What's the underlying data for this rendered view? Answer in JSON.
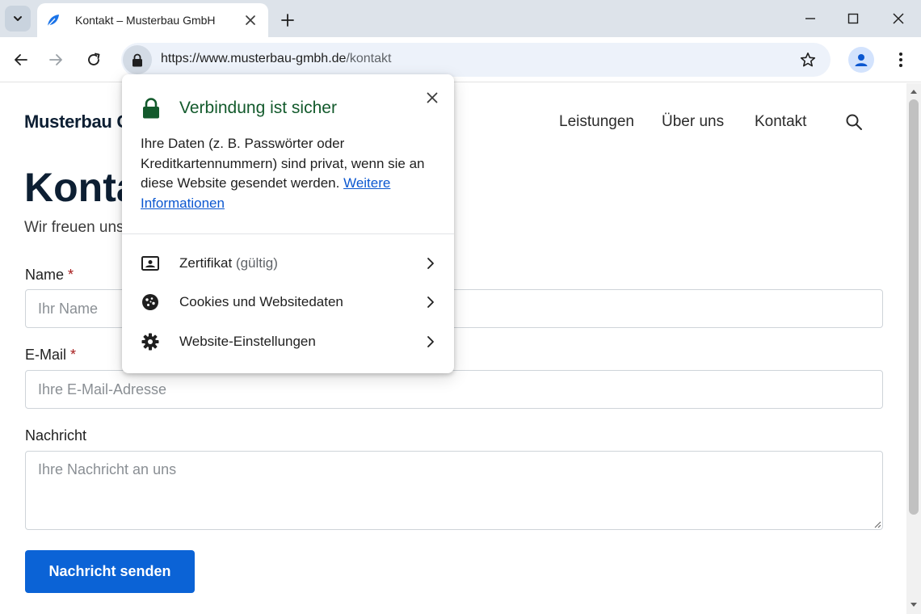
{
  "browser": {
    "tab": {
      "title": "Kontakt – Musterbau GmbH"
    },
    "address_bar": {
      "url_host": "https://www.musterbau-gmbh.de",
      "url_path": "/kontakt"
    }
  },
  "site": {
    "brand": "Musterbau G",
    "nav": [
      {
        "label": "Leistungen"
      },
      {
        "label": "Über uns"
      },
      {
        "label": "Kontakt"
      }
    ],
    "page_title": "Konta",
    "page_subtitle": "Wir freuen uns",
    "form": {
      "required_marker": "*",
      "name": {
        "label": "Name",
        "placeholder": "Ihr Name"
      },
      "email": {
        "label": "E-Mail",
        "placeholder": "Ihre E-Mail-Adresse"
      },
      "message": {
        "label": "Nachricht",
        "placeholder": "Ihre Nachricht an uns"
      },
      "submit_label": "Nachricht senden"
    }
  },
  "site_info_popup": {
    "title": "Verbindung ist sicher",
    "description": "Ihre Daten (z. B. Passwörter oder Kreditkartennummern) sind privat, wenn sie an diese Website gesendet werden.",
    "link": "Weitere Informationen",
    "rows": [
      {
        "label": "Zertifikat",
        "detail": "(gültig)",
        "icon": "certificate-icon"
      },
      {
        "label": "Cookies und Websitedaten",
        "detail": "",
        "icon": "cookie-icon"
      },
      {
        "label": "Website-Einstellungen",
        "detail": "",
        "icon": "gear-icon"
      }
    ]
  },
  "colors": {
    "accent": "#0b63d6",
    "secure_green": "#135a2c",
    "link_blue": "#0b57d0",
    "required_red": "#a61b1b",
    "tabstrip": "#dde3ea"
  }
}
